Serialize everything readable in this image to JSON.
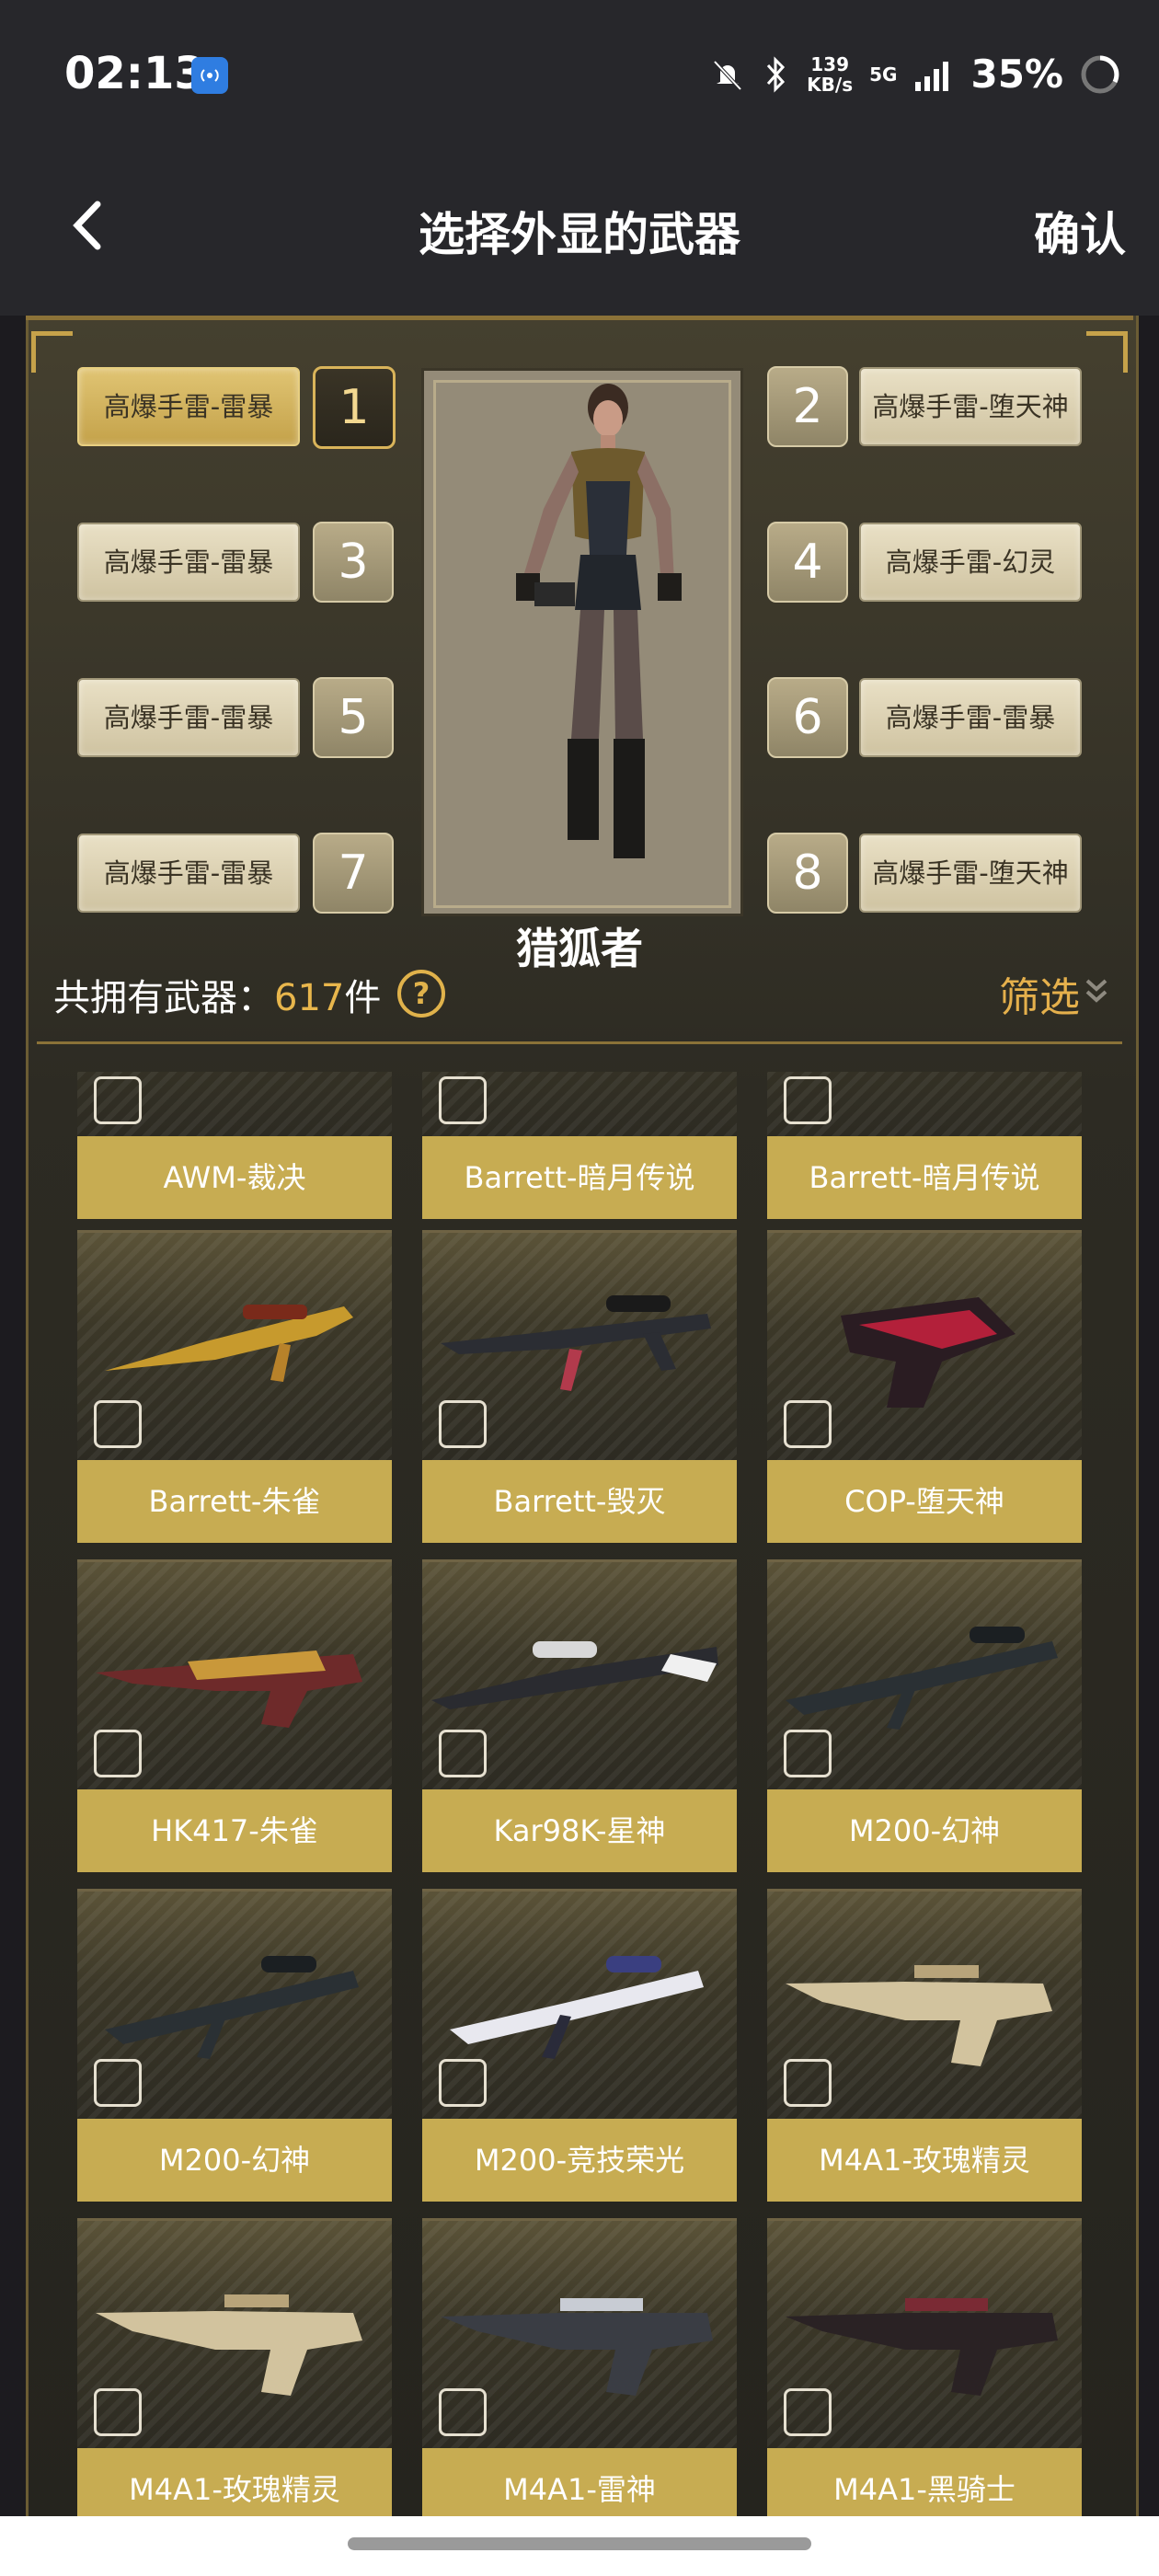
{
  "status_bar": {
    "time": "02:13",
    "net_speed_value": "139",
    "net_speed_unit": "KB/s",
    "network": "5G",
    "battery": "35%"
  },
  "header": {
    "title": "选择外显的武器",
    "confirm_label": "确认"
  },
  "loadout": {
    "character_name": "猎狐者",
    "slots": [
      {
        "num": "1",
        "label": "高爆手雷-雷暴",
        "active": true
      },
      {
        "num": "2",
        "label": "高爆手雷-堕天神",
        "active": false
      },
      {
        "num": "3",
        "label": "高爆手雷-雷暴",
        "active": false
      },
      {
        "num": "4",
        "label": "高爆手雷-幻灵",
        "active": false
      },
      {
        "num": "5",
        "label": "高爆手雷-雷暴",
        "active": false
      },
      {
        "num": "6",
        "label": "高爆手雷-雷暴",
        "active": false
      },
      {
        "num": "7",
        "label": "高爆手雷-雷暴",
        "active": false
      },
      {
        "num": "8",
        "label": "高爆手雷-堕天神",
        "active": false
      }
    ]
  },
  "inventory": {
    "count_prefix": "共拥有武器：",
    "count": "617",
    "count_suffix": "件",
    "help_symbol": "?",
    "filter_label": "筛选",
    "weapons": [
      {
        "name": "AWM-裁决",
        "icon": "sniper-rifle-icon"
      },
      {
        "name": "Barrett-暗月传说",
        "icon": "sniper-rifle-icon"
      },
      {
        "name": "Barrett-暗月传说",
        "icon": "sniper-rifle-icon"
      },
      {
        "name": "Barrett-朱雀",
        "icon": "sniper-rifle-icon"
      },
      {
        "name": "Barrett-毁灭",
        "icon": "sniper-rifle-icon"
      },
      {
        "name": "COP-堕天神",
        "icon": "pistol-icon"
      },
      {
        "name": "HK417-朱雀",
        "icon": "assault-rifle-icon"
      },
      {
        "name": "Kar98K-星神",
        "icon": "sniper-rifle-icon"
      },
      {
        "name": "M200-幻神",
        "icon": "sniper-rifle-icon"
      },
      {
        "name": "M200-幻神",
        "icon": "sniper-rifle-icon"
      },
      {
        "name": "M200-竞技荣光",
        "icon": "sniper-rifle-icon"
      },
      {
        "name": "M4A1-玫瑰精灵",
        "icon": "assault-rifle-icon"
      },
      {
        "name": "M4A1-玫瑰精灵",
        "icon": "assault-rifle-icon"
      },
      {
        "name": "M4A1-雷神",
        "icon": "assault-rifle-icon"
      },
      {
        "name": "M4A1-黑骑士",
        "icon": "assault-rifle-icon"
      }
    ]
  },
  "colors": {
    "accent_gold": "#e8b64c",
    "label_gold": "#c7ac52",
    "header_bg": "#27272b"
  }
}
